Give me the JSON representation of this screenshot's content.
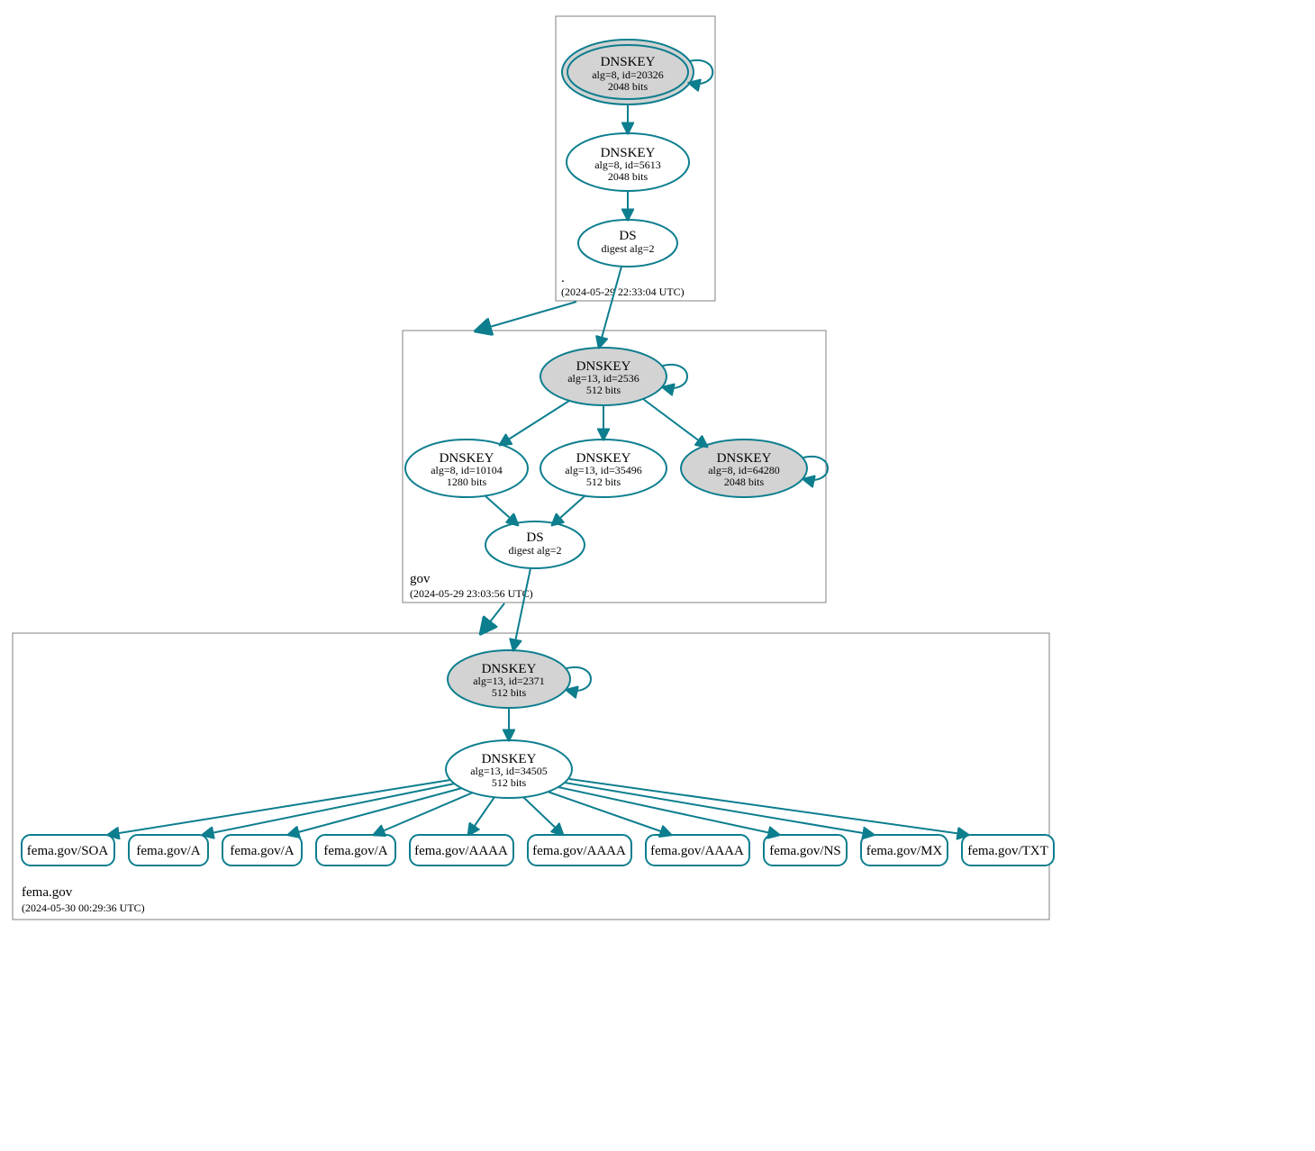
{
  "colors": {
    "stroke": "#0d7e8e",
    "sep_fill": "#d3d3d3"
  },
  "zones": {
    "root": {
      "label": ".",
      "timestamp": "(2024-05-29 22:33:04 UTC)"
    },
    "gov": {
      "label": "gov",
      "timestamp": "(2024-05-29 23:03:56 UTC)"
    },
    "fema": {
      "label": "fema.gov",
      "timestamp": "(2024-05-30 00:29:36 UTC)"
    }
  },
  "nodes": {
    "root_ksk": {
      "title": "DNSKEY",
      "line2": "alg=8, id=20326",
      "line3": "2048 bits"
    },
    "root_zsk": {
      "title": "DNSKEY",
      "line2": "alg=8, id=5613",
      "line3": "2048 bits"
    },
    "root_ds": {
      "title": "DS",
      "line2": "digest alg=2"
    },
    "gov_ksk": {
      "title": "DNSKEY",
      "line2": "alg=13, id=2536",
      "line3": "512 bits"
    },
    "gov_zsk1": {
      "title": "DNSKEY",
      "line2": "alg=8, id=10104",
      "line3": "1280 bits"
    },
    "gov_zsk2": {
      "title": "DNSKEY",
      "line2": "alg=13, id=35496",
      "line3": "512 bits"
    },
    "gov_zsk3": {
      "title": "DNSKEY",
      "line2": "alg=8, id=64280",
      "line3": "2048 bits"
    },
    "gov_ds": {
      "title": "DS",
      "line2": "digest alg=2"
    },
    "fema_ksk": {
      "title": "DNSKEY",
      "line2": "alg=13, id=2371",
      "line3": "512 bits"
    },
    "fema_zsk": {
      "title": "DNSKEY",
      "line2": "alg=13, id=34505",
      "line3": "512 bits"
    }
  },
  "rrsets": [
    "fema.gov/SOA",
    "fema.gov/A",
    "fema.gov/A",
    "fema.gov/A",
    "fema.gov/AAAA",
    "fema.gov/AAAA",
    "fema.gov/AAAA",
    "fema.gov/NS",
    "fema.gov/MX",
    "fema.gov/TXT"
  ]
}
